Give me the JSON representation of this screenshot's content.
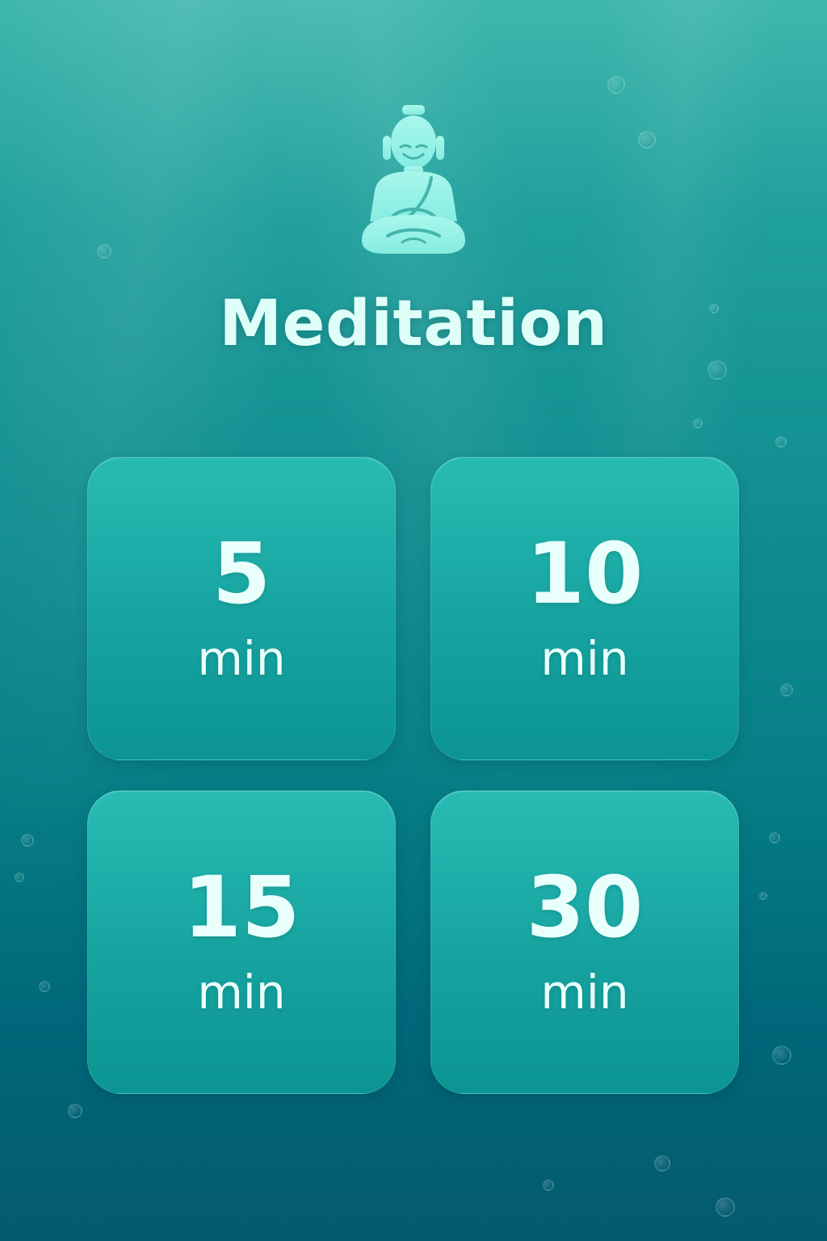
{
  "app": {
    "title": "Meditation",
    "icon": "meditating-buddha-icon"
  },
  "durations": [
    {
      "value": "5",
      "unit": "min"
    },
    {
      "value": "10",
      "unit": "min"
    },
    {
      "value": "15",
      "unit": "min"
    },
    {
      "value": "30",
      "unit": "min"
    }
  ],
  "colors": {
    "background_top": "#3fb7ad",
    "background_bottom": "#055a6e",
    "tile": "#16a3a0",
    "text": "#e9fffb",
    "icon": "#9ff3e7"
  }
}
